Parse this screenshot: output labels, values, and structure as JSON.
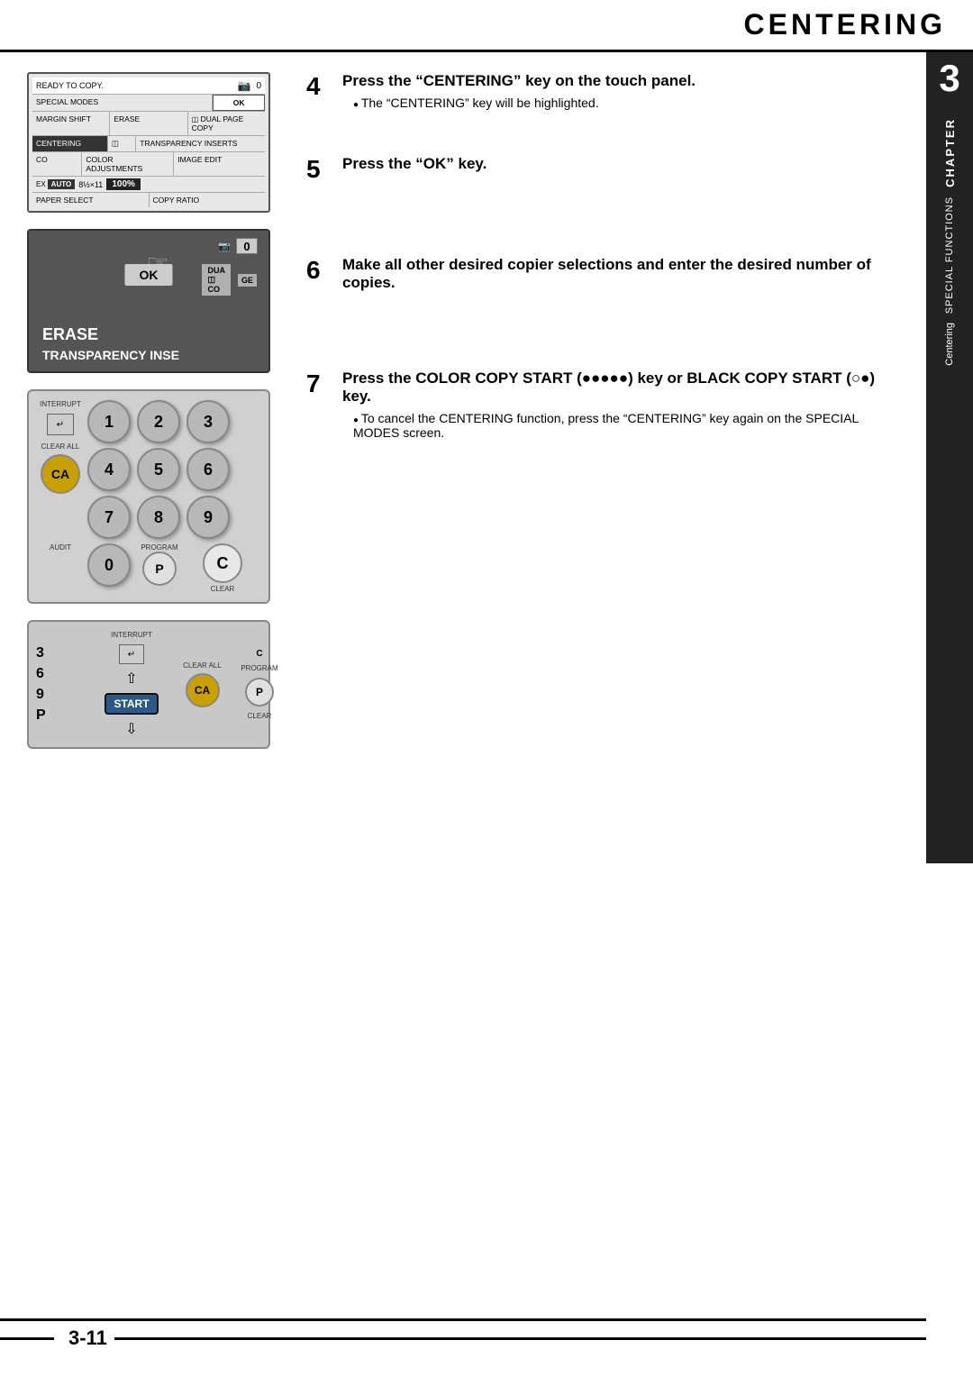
{
  "header": {
    "title": "CENTERING"
  },
  "sidebar": {
    "chapter_label": "CHAPTER",
    "chapter_number": "3",
    "special_functions": "SPECIAL FUNCTIONS",
    "centering": "Centering"
  },
  "steps": {
    "step4": {
      "number": "4",
      "title": "Press the “CENTERING” key on the touch panel.",
      "bullet": "The “CENTERING” key will be highlighted."
    },
    "step5": {
      "number": "5",
      "title": "Press the “OK” key."
    },
    "step6": {
      "number": "6",
      "title": "Make all other desired copier selections and enter the desired number of copies."
    },
    "step7": {
      "number": "7",
      "title": "Press the COLOR COPY START (●●●●●) key or BLACK COPY START (○●) key.",
      "bullet": "To cancel the CENTERING function, press the “CENTERING” key again on the SPECIAL MODES screen."
    }
  },
  "touch_panel": {
    "ready_text": "READY TO COPY.",
    "special_modes": "SPECIAL MODES",
    "ok_btn": "OK",
    "margin_shift": "MARGIN SHIFT",
    "erase": "ERASE",
    "dual_page_copy": "DUAL PAGE COPY",
    "centering": "CENTERING",
    "transparency_inserts": "TRANSPARENCY INSERTS",
    "color_adjustments": "COLOR ADJUSTMENTS",
    "image_edit": "IMAGE EDIT",
    "auto_label": "AUTO",
    "paper_size": "8½×11",
    "ratio": "100%",
    "paper_select": "PAPER SELECT",
    "copy_ratio": "COPY RATIO"
  },
  "ok_panel": {
    "erase": "ERASE",
    "transparency": "TRANSPARENCY INSE",
    "dual_copy": "DU⁠A\nCO",
    "age": "GE",
    "ok_btn": "OK"
  },
  "keypad": {
    "keys": [
      "1",
      "2",
      "3",
      "4",
      "5",
      "6",
      "7",
      "8",
      "9",
      "0"
    ],
    "interrupt": "INTERRUPT",
    "clear_all": "CLEAR ALL",
    "ca_label": "CA",
    "c_label": "C",
    "audit": "AUDIT",
    "program": "PROGRAM",
    "p_label": "P",
    "clear": "CLEAR"
  },
  "start_panel": {
    "nums": [
      "3",
      "6",
      "9",
      "P"
    ],
    "interrupt": "INTERRUPT",
    "clear_all": "CLEAR ALL",
    "ca_label": "CA",
    "start_label": "START",
    "c_label": "C",
    "clear": "CLEAR",
    "program": "PROGRAM",
    "p_label": "P"
  },
  "page_number": "3-11"
}
